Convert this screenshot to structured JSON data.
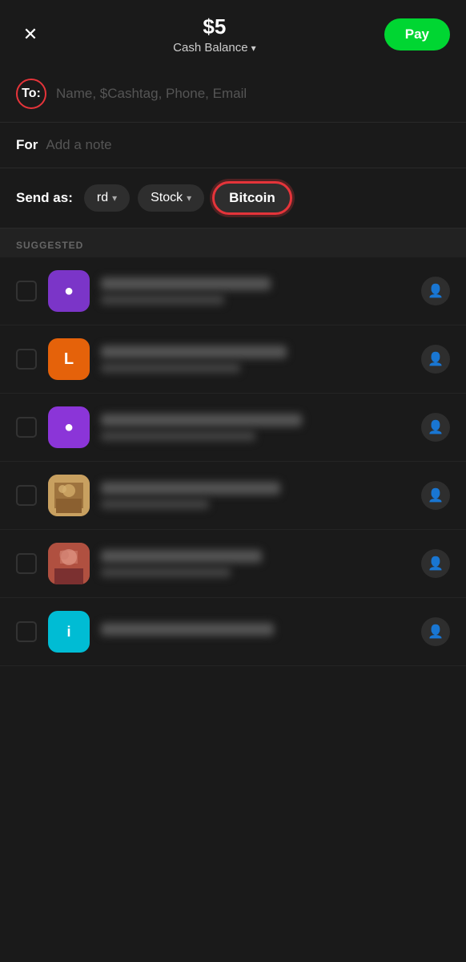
{
  "header": {
    "amount": "$5",
    "balance_label": "Cash Balance",
    "pay_label": "Pay",
    "close_icon": "✕"
  },
  "to_field": {
    "label": "To:",
    "placeholder": "Name, $Cashtag, Phone, Email"
  },
  "for_field": {
    "label": "For",
    "placeholder": "Add a note"
  },
  "send_as": {
    "label": "Send as:",
    "standard_label": "rd",
    "stock_label": "Stock",
    "bitcoin_label": "Bitcoin"
  },
  "suggested": {
    "header": "SUGGESTED"
  },
  "contacts": [
    {
      "id": 1,
      "avatar_type": "purple",
      "initial": "●",
      "name_width": "55%",
      "sub_width": "40%"
    },
    {
      "id": 2,
      "avatar_type": "orange",
      "initial": "L",
      "name_width": "60%",
      "sub_width": "45%"
    },
    {
      "id": 3,
      "avatar_type": "purple2",
      "initial": "●",
      "name_width": "65%",
      "sub_width": "50%"
    },
    {
      "id": 4,
      "avatar_type": "photo4",
      "initial": "",
      "name_width": "58%",
      "sub_width": "35%"
    },
    {
      "id": 5,
      "avatar_type": "photo5",
      "initial": "",
      "name_width": "52%",
      "sub_width": "42%"
    },
    {
      "id": 6,
      "avatar_type": "cyan",
      "initial": "i",
      "name_width": "56%",
      "sub_width": "0%"
    }
  ]
}
